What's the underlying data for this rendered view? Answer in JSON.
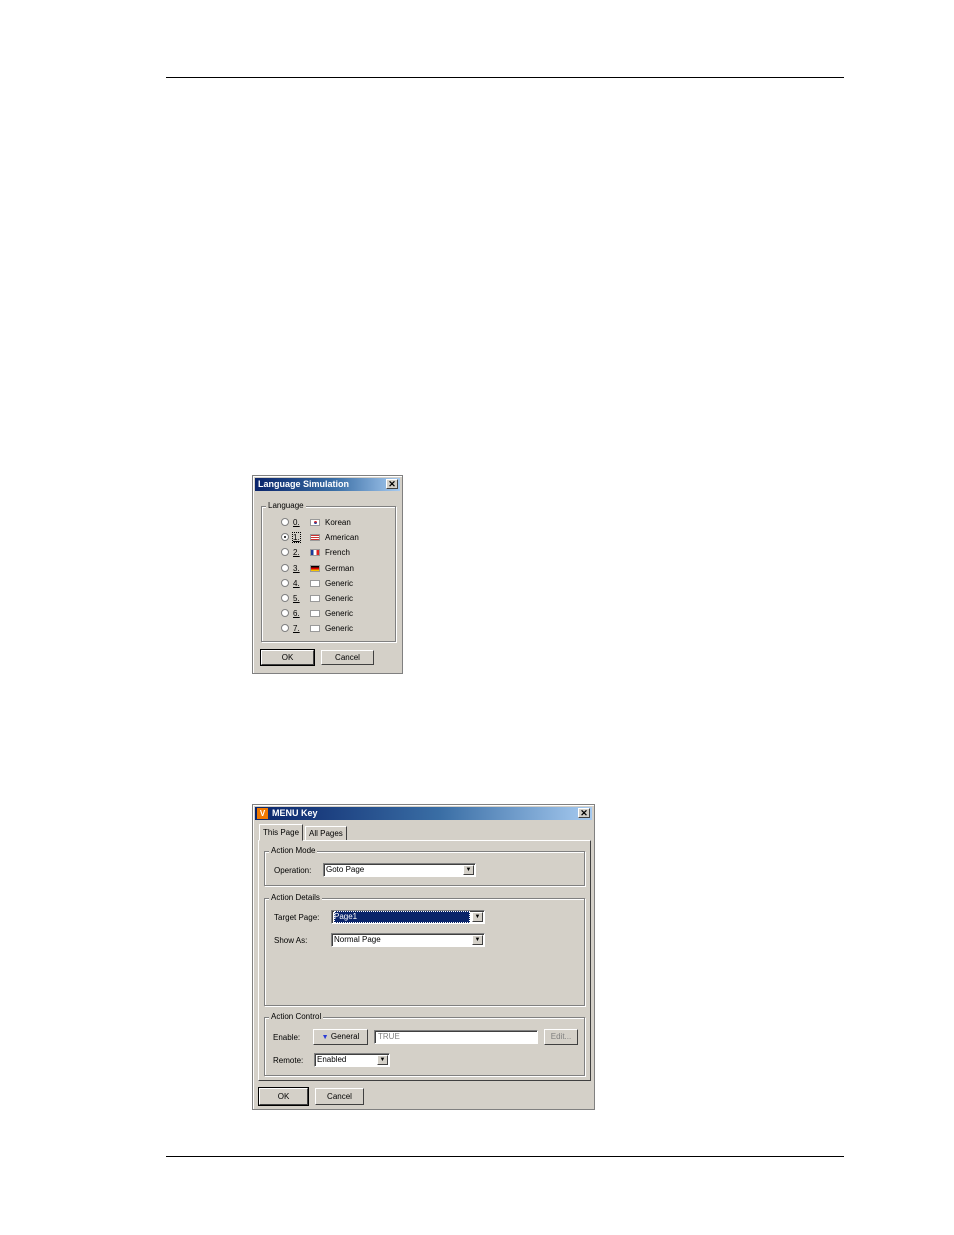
{
  "lang_dialog": {
    "title": "Language Simulation",
    "group_label": "Language",
    "options": [
      {
        "num": "0.",
        "name": "Korean",
        "selected": false,
        "flag": "korea-flag-icon"
      },
      {
        "num": "1.",
        "name": "American",
        "selected": true,
        "flag": "usa-flag-icon"
      },
      {
        "num": "2.",
        "name": "French",
        "selected": false,
        "flag": "france-flag-icon"
      },
      {
        "num": "3.",
        "name": "German",
        "selected": false,
        "flag": "germany-flag-icon"
      },
      {
        "num": "4.",
        "name": "Generic",
        "selected": false,
        "flag": "blank-flag-icon"
      },
      {
        "num": "5.",
        "name": "Generic",
        "selected": false,
        "flag": "blank-flag-icon"
      },
      {
        "num": "6.",
        "name": "Generic",
        "selected": false,
        "flag": "blank-flag-icon"
      },
      {
        "num": "7.",
        "name": "Generic",
        "selected": false,
        "flag": "blank-flag-icon"
      }
    ],
    "ok_label": "OK",
    "cancel_label": "Cancel"
  },
  "menu_dialog": {
    "title": "MENU Key",
    "tabs": [
      "This Page",
      "All Pages"
    ],
    "action_mode": {
      "group_label": "Action Mode",
      "operation_label": "Operation:",
      "operation_value": "Goto Page"
    },
    "action_details": {
      "group_label": "Action Details",
      "target_label": "Target Page:",
      "target_value": "Page1",
      "show_as_label": "Show As:",
      "show_as_value": "Normal Page"
    },
    "action_control": {
      "group_label": "Action Control",
      "enable_label": "Enable:",
      "general_label": "General",
      "condition_value": "TRUE",
      "edit_label": "Edit...",
      "remote_label": "Remote:",
      "remote_value": "Enabled"
    },
    "ok_label": "OK",
    "cancel_label": "Cancel"
  }
}
